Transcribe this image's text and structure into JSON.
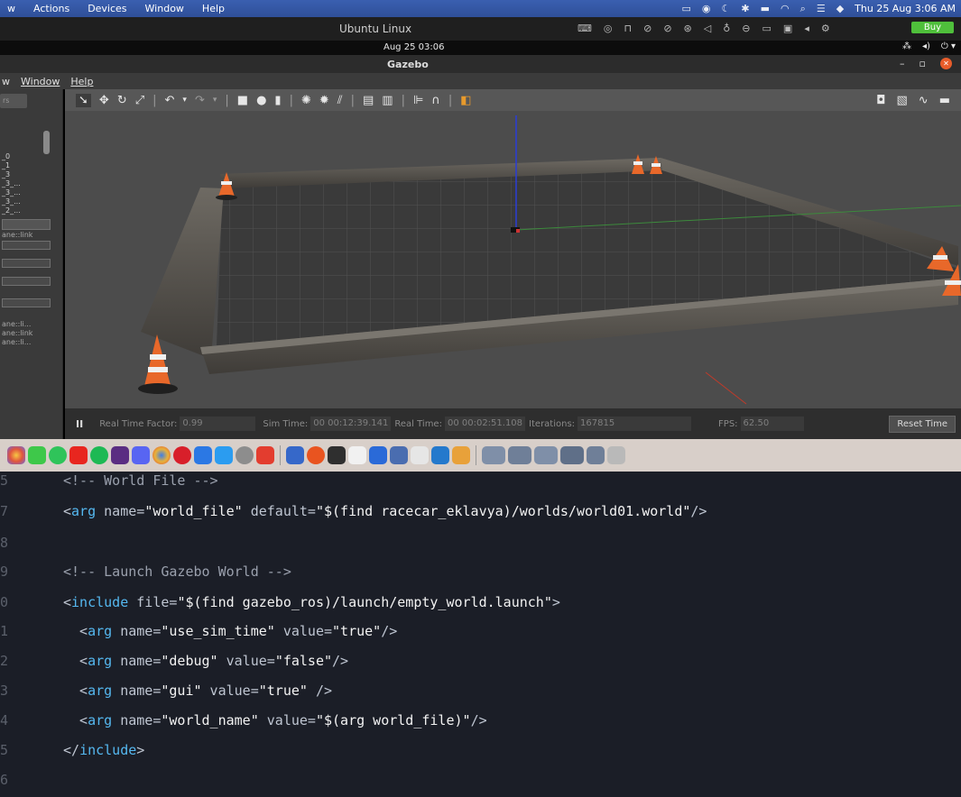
{
  "mac_menubar": {
    "items": [
      "w",
      "Actions",
      "Devices",
      "Window",
      "Help"
    ],
    "clock": "Thu 25 Aug  3:06 AM"
  },
  "vm_titlebar": {
    "title": "Ubuntu Linux",
    "buy_label": "Buy"
  },
  "ubuntu_panel": {
    "clock": "Aug 25  03:06"
  },
  "gazebo": {
    "title": "Gazebo",
    "menu": [
      "w",
      "Window",
      "Help"
    ],
    "left_panel": {
      "tab": "rs",
      "lines": [
        "_0",
        "_1",
        "_3",
        "_3_...",
        "_3_...",
        "_3_...",
        "_2_..."
      ],
      "link_label": "ane::link",
      "bottom_lines": [
        "ane::li...",
        "ane::link",
        "ane::li..."
      ]
    },
    "status": {
      "pause": "II",
      "real_time_factor_label": "Real Time Factor:",
      "real_time_factor": "0.99",
      "sim_time_label": "Sim Time:",
      "sim_time": "00 00:12:39.141",
      "real_time_label": "Real Time:",
      "real_time": "00 00:02:51.108",
      "iterations_label": "Iterations:",
      "iterations": "167815",
      "fps_label": "FPS:",
      "fps": "62.50",
      "reset_label": "Reset Time"
    }
  },
  "code": {
    "line_numbers": [
      "5",
      "7",
      "8",
      "9",
      "0",
      "1",
      "2",
      "3",
      "4",
      "5",
      "6"
    ],
    "lines": [
      {
        "c": "<!-- World File -->"
      },
      {
        "pre": "<",
        "tag": "arg",
        "a1": " name=",
        "v1": "\"world_file\"",
        "a2": " default=",
        "v2": "\"$(find racecar_eklavya)/worlds/world01.world\"",
        "end": "/>"
      },
      {
        "c": ""
      },
      {
        "c": "<!-- Launch Gazebo World -->"
      },
      {
        "pre": "<",
        "tag": "include",
        "a1": " file=",
        "v1": "\"$(find gazebo_ros)/launch/empty_world.launch\"",
        "a2": "",
        "v2": "",
        "end": ">"
      },
      {
        "pre": "  <",
        "tag": "arg",
        "a1": " name=",
        "v1": "\"use_sim_time\"",
        "a2": " value=",
        "v2": "\"true\"",
        "end": "/>"
      },
      {
        "pre": "  <",
        "tag": "arg",
        "a1": " name=",
        "v1": "\"debug\"",
        "a2": " value=",
        "v2": "\"false\"",
        "end": "/>"
      },
      {
        "pre": "  <",
        "tag": "arg",
        "a1": " name=",
        "v1": "\"gui\"",
        "a2": " value=",
        "v2": "\"true\"",
        "end": " />"
      },
      {
        "pre": "  <",
        "tag": "arg",
        "a1": " name=",
        "v1": "\"world_name\"",
        "a2": " value=",
        "v2": "\"$(arg world_file)\"",
        "end": "/>"
      },
      {
        "pre": "</",
        "tag": "include",
        "a1": "",
        "v1": "",
        "a2": "",
        "v2": "",
        "end": ">"
      }
    ]
  }
}
